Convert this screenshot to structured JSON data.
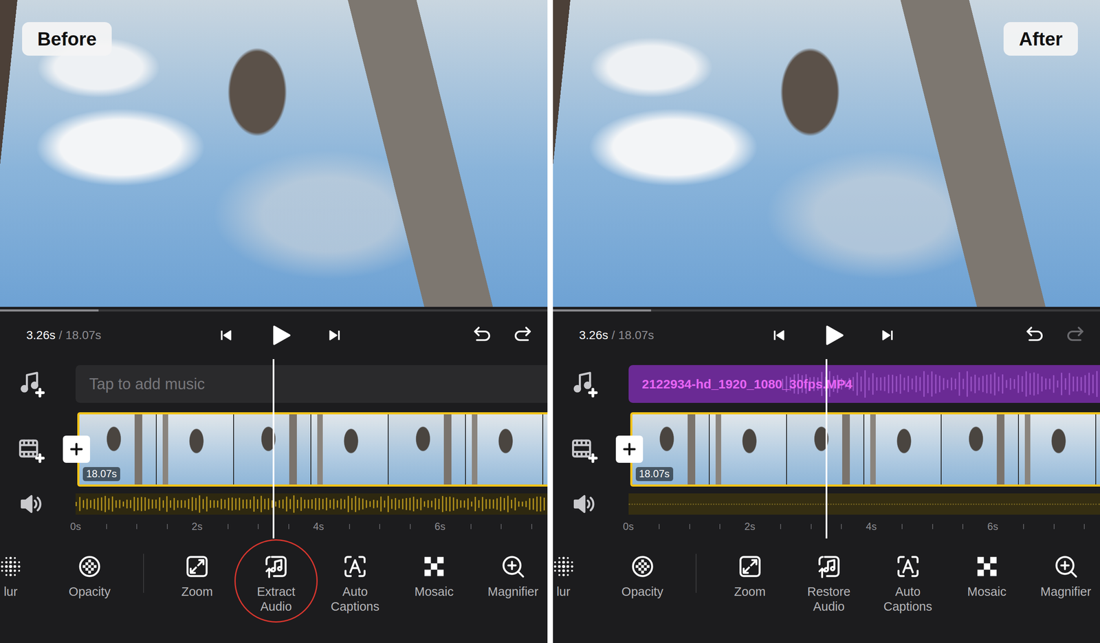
{
  "panels": [
    {
      "label": "Before",
      "time": {
        "current": "3.26s",
        "separator": "/",
        "total": "18.07s"
      },
      "progress": 0.18,
      "undo": {
        "enabled": true
      },
      "redo": {
        "enabled": true
      },
      "music_track": {
        "kind": "empty",
        "text": "Tap to add music"
      },
      "clip": {
        "duration": "18.07s"
      },
      "audio_track": {
        "kind": "waveform"
      },
      "ruler": [
        "0s",
        "2s",
        "4s",
        "6s"
      ],
      "tools": [
        {
          "kind": "blur",
          "label": "lur",
          "highlighted": false
        },
        {
          "kind": "opacity",
          "label": "Opacity",
          "highlighted": false
        },
        {
          "kind": "zoom",
          "label": "Zoom",
          "highlighted": false
        },
        {
          "kind": "audio",
          "label": "Extract Audio",
          "highlighted": true
        },
        {
          "kind": "captions",
          "label": "Auto Captions",
          "highlighted": false
        },
        {
          "kind": "mosaic",
          "label": "Mosaic",
          "highlighted": false
        },
        {
          "kind": "magnifier",
          "label": "Magnifier",
          "highlighted": false
        }
      ]
    },
    {
      "label": "After",
      "time": {
        "current": "3.26s",
        "separator": "/",
        "total": "18.07s"
      },
      "progress": 0.18,
      "undo": {
        "enabled": true
      },
      "redo": {
        "enabled": false
      },
      "music_track": {
        "kind": "clip",
        "text": "2122934-hd_1920_1080_30fps.MP4"
      },
      "clip": {
        "duration": "18.07s"
      },
      "audio_track": {
        "kind": "detached"
      },
      "ruler": [
        "0s",
        "2s",
        "4s",
        "6s"
      ],
      "tools": [
        {
          "kind": "blur",
          "label": "lur",
          "highlighted": false
        },
        {
          "kind": "opacity",
          "label": "Opacity",
          "highlighted": false
        },
        {
          "kind": "zoom",
          "label": "Zoom",
          "highlighted": false
        },
        {
          "kind": "audio",
          "label": "Restore Audio",
          "highlighted": false
        },
        {
          "kind": "captions",
          "label": "Auto Captions",
          "highlighted": false
        },
        {
          "kind": "mosaic",
          "label": "Mosaic",
          "highlighted": false
        },
        {
          "kind": "magnifier",
          "label": "Magnifier",
          "highlighted": false
        }
      ]
    }
  ]
}
